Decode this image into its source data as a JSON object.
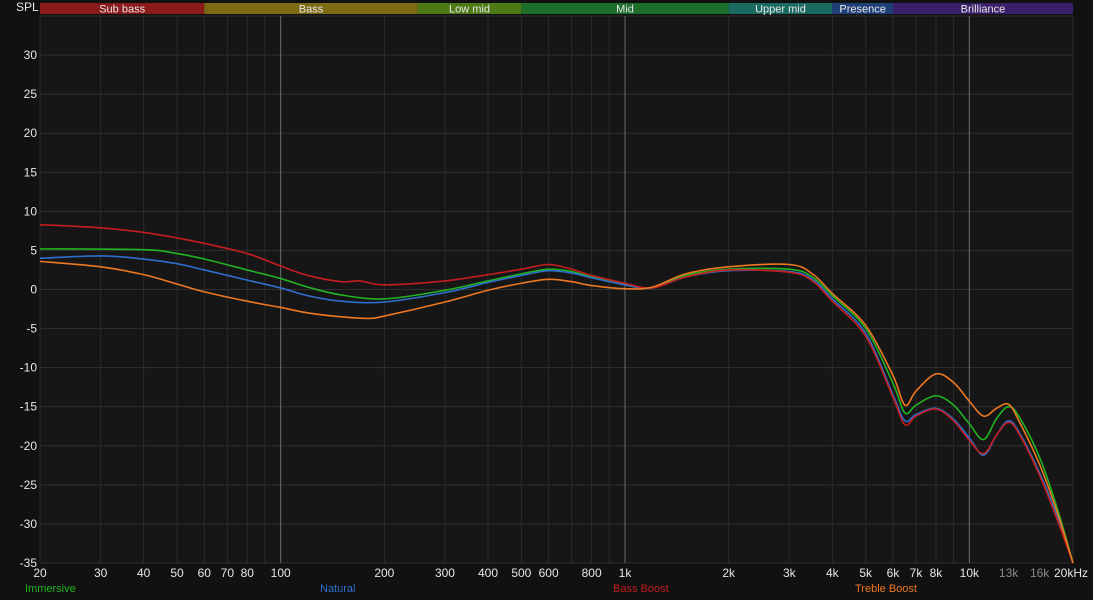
{
  "chart_data": {
    "type": "line",
    "ylabel": "SPL",
    "x_scale": "log",
    "xlim": [
      20,
      20000
    ],
    "ylim": [
      -35,
      35
    ],
    "y_ticks": [
      30,
      25,
      20,
      15,
      10,
      5,
      0,
      -5,
      -10,
      -15,
      -20,
      -25,
      -30,
      -35
    ],
    "x_ticks": [
      {
        "value": 20,
        "label": "20"
      },
      {
        "value": 30,
        "label": "30"
      },
      {
        "value": 40,
        "label": "40"
      },
      {
        "value": 50,
        "label": "50"
      },
      {
        "value": 60,
        "label": "60"
      },
      {
        "value": 70,
        "label": "70"
      },
      {
        "value": 80,
        "label": "80"
      },
      {
        "value": 100,
        "label": "100"
      },
      {
        "value": 200,
        "label": "200"
      },
      {
        "value": 300,
        "label": "300"
      },
      {
        "value": 400,
        "label": "400"
      },
      {
        "value": 500,
        "label": "500"
      },
      {
        "value": 600,
        "label": "600"
      },
      {
        "value": 800,
        "label": "800"
      },
      {
        "value": 1000,
        "label": "1k"
      },
      {
        "value": 2000,
        "label": "2k"
      },
      {
        "value": 3000,
        "label": "3k"
      },
      {
        "value": 4000,
        "label": "4k"
      },
      {
        "value": 5000,
        "label": "5k"
      },
      {
        "value": 6000,
        "label": "6k"
      },
      {
        "value": 7000,
        "label": "7k"
      },
      {
        "value": 8000,
        "label": "8k"
      },
      {
        "value": 10000,
        "label": "10k"
      },
      {
        "value": 13000,
        "label": "13k",
        "dim": true
      },
      {
        "value": 16000,
        "label": "16k",
        "dim": true
      },
      {
        "value": 20000,
        "label": "20kHz"
      }
    ],
    "bands": [
      {
        "name": "Sub bass",
        "from": 20,
        "to": 60,
        "color": "#8b1a1a"
      },
      {
        "name": "Bass",
        "from": 60,
        "to": 250,
        "color": "#7d6a14"
      },
      {
        "name": "Low mid",
        "from": 250,
        "to": 500,
        "color": "#4d7a16"
      },
      {
        "name": "Mid",
        "from": 500,
        "to": 2000,
        "color": "#1d6e2a"
      },
      {
        "name": "Upper mid",
        "from": 2000,
        "to": 4000,
        "color": "#1b6a62"
      },
      {
        "name": "Presence",
        "from": 4000,
        "to": 6000,
        "color": "#1f3f78"
      },
      {
        "name": "Brilliance",
        "from": 6000,
        "to": 20000,
        "color": "#3a1f6a"
      }
    ],
    "series": [
      {
        "name": "Immersive",
        "color": "#22b322",
        "points": [
          [
            20,
            5.2
          ],
          [
            40,
            5.1
          ],
          [
            50,
            4.6
          ],
          [
            60,
            3.9
          ],
          [
            80,
            2.5
          ],
          [
            100,
            1.4
          ],
          [
            120,
            0.3
          ],
          [
            150,
            -0.7
          ],
          [
            200,
            -1.2
          ],
          [
            300,
            -0.1
          ],
          [
            400,
            1.1
          ],
          [
            500,
            2.0
          ],
          [
            600,
            2.6
          ],
          [
            700,
            2.3
          ],
          [
            800,
            1.6
          ],
          [
            1000,
            0.6
          ],
          [
            1200,
            0.2
          ],
          [
            1500,
            1.8
          ],
          [
            2000,
            2.6
          ],
          [
            3000,
            2.6
          ],
          [
            3500,
            1.6
          ],
          [
            4000,
            -0.8
          ],
          [
            5000,
            -5.0
          ],
          [
            6000,
            -12.0
          ],
          [
            6500,
            -15.8
          ],
          [
            7000,
            -14.8
          ],
          [
            8000,
            -13.6
          ],
          [
            9000,
            -14.8
          ],
          [
            10000,
            -17.2
          ],
          [
            11000,
            -19.2
          ],
          [
            12000,
            -16.5
          ],
          [
            13000,
            -15.0
          ],
          [
            14000,
            -16.4
          ],
          [
            16000,
            -21.5
          ],
          [
            18000,
            -28
          ],
          [
            20000,
            -35
          ]
        ]
      },
      {
        "name": "Natural",
        "color": "#2f6fcc",
        "points": [
          [
            20,
            4.0
          ],
          [
            30,
            4.3
          ],
          [
            40,
            3.9
          ],
          [
            50,
            3.3
          ],
          [
            60,
            2.5
          ],
          [
            80,
            1.2
          ],
          [
            100,
            0.2
          ],
          [
            120,
            -0.8
          ],
          [
            150,
            -1.5
          ],
          [
            200,
            -1.6
          ],
          [
            300,
            -0.4
          ],
          [
            400,
            0.9
          ],
          [
            500,
            1.8
          ],
          [
            600,
            2.4
          ],
          [
            700,
            2.1
          ],
          [
            800,
            1.5
          ],
          [
            1000,
            0.6
          ],
          [
            1200,
            0.2
          ],
          [
            1500,
            1.6
          ],
          [
            2000,
            2.4
          ],
          [
            3000,
            2.3
          ],
          [
            3500,
            1.3
          ],
          [
            4000,
            -1.2
          ],
          [
            5000,
            -5.6
          ],
          [
            6000,
            -13.5
          ],
          [
            6500,
            -16.8
          ],
          [
            7000,
            -16.0
          ],
          [
            8000,
            -15.2
          ],
          [
            9000,
            -16.6
          ],
          [
            10000,
            -19.0
          ],
          [
            11000,
            -21.2
          ],
          [
            12000,
            -18.6
          ],
          [
            13000,
            -16.8
          ],
          [
            14000,
            -18.4
          ],
          [
            16000,
            -23.5
          ],
          [
            18000,
            -29
          ],
          [
            20000,
            -35
          ]
        ]
      },
      {
        "name": "Bass Boost",
        "color": "#c41e1e",
        "points": [
          [
            20,
            8.3
          ],
          [
            30,
            7.9
          ],
          [
            40,
            7.3
          ],
          [
            50,
            6.6
          ],
          [
            60,
            5.9
          ],
          [
            80,
            4.6
          ],
          [
            100,
            3.0
          ],
          [
            120,
            1.8
          ],
          [
            150,
            1.0
          ],
          [
            170,
            1.1
          ],
          [
            200,
            0.6
          ],
          [
            300,
            1.1
          ],
          [
            400,
            1.9
          ],
          [
            500,
            2.6
          ],
          [
            600,
            3.2
          ],
          [
            700,
            2.6
          ],
          [
            800,
            1.8
          ],
          [
            1000,
            0.8
          ],
          [
            1200,
            0.2
          ],
          [
            1500,
            1.6
          ],
          [
            2000,
            2.5
          ],
          [
            3000,
            2.2
          ],
          [
            3500,
            1.1
          ],
          [
            4000,
            -1.5
          ],
          [
            5000,
            -6.0
          ],
          [
            6000,
            -13.8
          ],
          [
            6500,
            -17.3
          ],
          [
            7000,
            -16.2
          ],
          [
            8000,
            -15.3
          ],
          [
            9000,
            -16.8
          ],
          [
            10000,
            -19.3
          ],
          [
            11000,
            -21.0
          ],
          [
            12000,
            -18.6
          ],
          [
            13000,
            -17.0
          ],
          [
            14000,
            -18.6
          ],
          [
            16000,
            -23.8
          ],
          [
            18000,
            -29.5
          ],
          [
            20000,
            -35
          ]
        ]
      },
      {
        "name": "Treble Boost",
        "color": "#ee7722",
        "points": [
          [
            20,
            3.6
          ],
          [
            30,
            2.9
          ],
          [
            40,
            1.9
          ],
          [
            50,
            0.7
          ],
          [
            60,
            -0.3
          ],
          [
            80,
            -1.5
          ],
          [
            100,
            -2.3
          ],
          [
            120,
            -3.0
          ],
          [
            150,
            -3.5
          ],
          [
            180,
            -3.7
          ],
          [
            200,
            -3.4
          ],
          [
            300,
            -1.6
          ],
          [
            400,
            -0.1
          ],
          [
            500,
            0.8
          ],
          [
            600,
            1.3
          ],
          [
            700,
            1.0
          ],
          [
            800,
            0.5
          ],
          [
            1000,
            0.1
          ],
          [
            1200,
            0.3
          ],
          [
            1500,
            2.0
          ],
          [
            2000,
            2.9
          ],
          [
            3000,
            3.2
          ],
          [
            3500,
            2.0
          ],
          [
            4000,
            -0.5
          ],
          [
            5000,
            -4.6
          ],
          [
            6000,
            -11.0
          ],
          [
            6500,
            -14.8
          ],
          [
            7000,
            -13.0
          ],
          [
            8000,
            -10.8
          ],
          [
            9000,
            -11.9
          ],
          [
            10000,
            -14.3
          ],
          [
            11000,
            -16.2
          ],
          [
            12000,
            -15.2
          ],
          [
            13000,
            -14.7
          ],
          [
            14000,
            -17.0
          ],
          [
            16000,
            -22.4
          ],
          [
            18000,
            -28.5
          ],
          [
            20000,
            -35
          ]
        ]
      }
    ]
  }
}
